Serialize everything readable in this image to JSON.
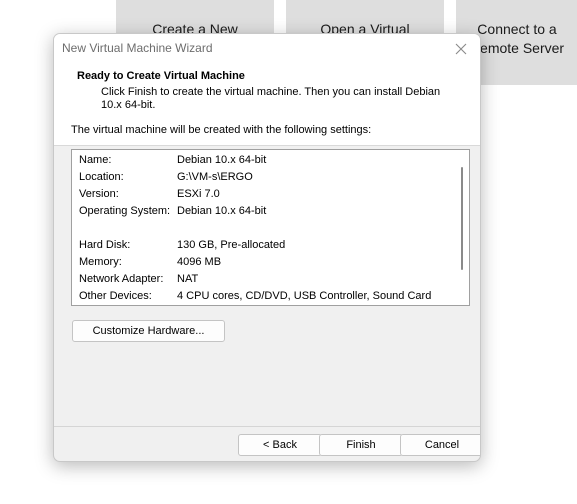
{
  "background": {
    "tiles": [
      {
        "label_line1": "Create a New",
        "label_line2": ""
      },
      {
        "label_line1": "Open a Virtual",
        "label_line2": ""
      },
      {
        "label_line1": "Connect to a",
        "label_line2": "Remote Server"
      }
    ]
  },
  "dialog": {
    "title": "New Virtual Machine Wizard",
    "close_icon": "close-icon",
    "header": {
      "title": "Ready to Create Virtual Machine",
      "description": "Click Finish to create the virtual machine. Then you can install Debian 10.x 64-bit."
    },
    "intro": "The virtual machine will be created with the following settings:",
    "settings": [
      {
        "key": "Name:",
        "value": "Debian 10.x 64-bit"
      },
      {
        "key": "Location:",
        "value": "G:\\VM-s\\ERGO"
      },
      {
        "key": "Version:",
        "value": "ESXi 7.0"
      },
      {
        "key": "Operating System:",
        "value": "Debian 10.x 64-bit"
      },
      {
        "key": "Hard Disk:",
        "value": "130 GB, Pre-allocated"
      },
      {
        "key": "Memory:",
        "value": "4096 MB"
      },
      {
        "key": "Network Adapter:",
        "value": "NAT"
      },
      {
        "key": "Other Devices:",
        "value": "4 CPU cores, CD/DVD, USB Controller, Sound Card"
      }
    ],
    "customize_button": "Customize Hardware...",
    "buttons": {
      "back": "< Back",
      "finish": "Finish",
      "cancel": "Cancel"
    }
  }
}
